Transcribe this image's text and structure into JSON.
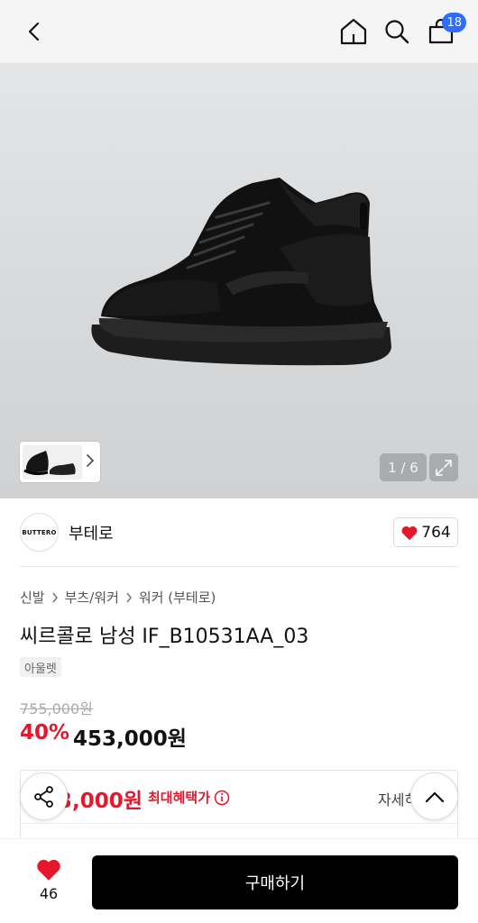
{
  "header": {
    "bag_count": "18",
    "icons": [
      "back-icon",
      "home-icon",
      "search-icon",
      "shopping-bag-icon"
    ]
  },
  "gallery": {
    "counter": "1 / 6",
    "icons": [
      "chevron-right-icon",
      "expand-icon"
    ]
  },
  "brand": {
    "logo_text": "BUTTERO",
    "name": "부테로",
    "likes": "764"
  },
  "breadcrumb": [
    "신발",
    "부츠/워커",
    "워커 (부테로)"
  ],
  "product": {
    "title": "씨르콜로 남성 IF_B10531AA_03",
    "tag": "아울렛",
    "original_price": "755,000원",
    "discount": "40%",
    "price": "453,000원"
  },
  "benefit": {
    "price": "3,000원",
    "label": "최대혜택가",
    "detail": "자세히"
  },
  "bottom_bar": {
    "wish_count": "46",
    "buy_label": "구매하기"
  },
  "colors": {
    "accent_red": "#e6172d",
    "badge_blue": "#2f6bff",
    "buy_button": "#000000"
  }
}
